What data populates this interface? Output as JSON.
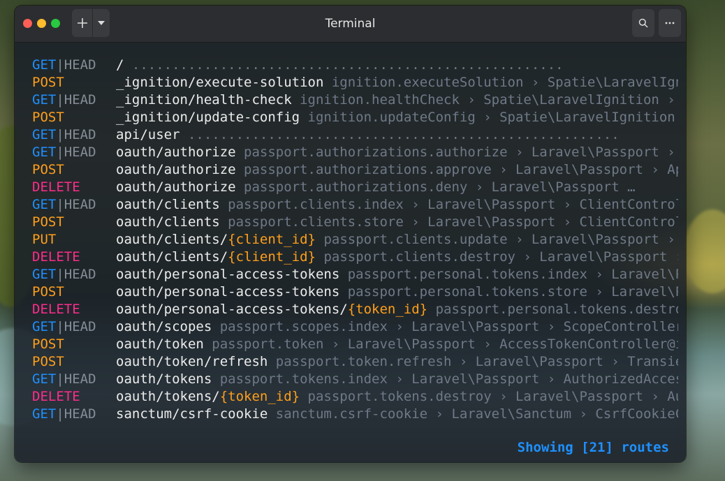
{
  "window": {
    "title": "Terminal",
    "new_tab_label": "+",
    "dropdown_label": "▾",
    "search_label": "⌕",
    "menu_label": "⋯"
  },
  "colors": {
    "get": "#1e90ff",
    "post": "#ff9f1a",
    "delete": "#ff2c8c",
    "put": "#ff9f1a",
    "head": "#858d98",
    "path": "#ececec",
    "dim": "#6f7987",
    "footer": "#1e90ff"
  },
  "routes": [
    {
      "method": "GET",
      "head": true,
      "path": "/",
      "param": "",
      "suffix": "",
      "info": " ......................................................"
    },
    {
      "method": "POST",
      "head": false,
      "path": "_ignition/execute-solution",
      "param": "",
      "suffix": "",
      "info": " ignition.executeSolution › Spatie\\LaravelIgnition › ExecuteSolutionController"
    },
    {
      "method": "GET",
      "head": true,
      "path": "_ignition/health-check",
      "param": "",
      "suffix": "",
      "info": " ignition.healthCheck › Spatie\\LaravelIgnition › HealthCheckController"
    },
    {
      "method": "POST",
      "head": false,
      "path": "_ignition/update-config",
      "param": "",
      "suffix": "",
      "info": " ignition.updateConfig › Spatie\\LaravelIgnition › UpdateConfigController"
    },
    {
      "method": "GET",
      "head": true,
      "path": "api/user",
      "param": "",
      "suffix": "",
      "info": " ......................................................"
    },
    {
      "method": "GET",
      "head": true,
      "path": "oauth/authorize",
      "param": "",
      "suffix": "",
      "info": " passport.authorizations.authorize › Laravel\\Passport › AuthorizationController"
    },
    {
      "method": "POST",
      "head": false,
      "path": "oauth/authorize",
      "param": "",
      "suffix": "",
      "info": " passport.authorizations.approve › Laravel\\Passport › ApproveAuthorizationController"
    },
    {
      "method": "DELETE",
      "head": false,
      "path": "oauth/authorize",
      "param": "",
      "suffix": "",
      "info": " passport.authorizations.deny › Laravel\\Passport  …"
    },
    {
      "method": "GET",
      "head": true,
      "path": "oauth/clients",
      "param": "",
      "suffix": "",
      "info": " passport.clients.index › Laravel\\Passport › ClientController@forUser"
    },
    {
      "method": "POST",
      "head": false,
      "path": "oauth/clients",
      "param": "",
      "suffix": "",
      "info": " passport.clients.store › Laravel\\Passport › ClientController@store"
    },
    {
      "method": "PUT",
      "head": false,
      "path": "oauth/clients/",
      "param": "{client_id}",
      "suffix": "",
      "info": " passport.clients.update › Laravel\\Passport › ClientController@update"
    },
    {
      "method": "DELETE",
      "head": false,
      "path": "oauth/clients/",
      "param": "{client_id}",
      "suffix": "",
      "info": " passport.clients.destroy › Laravel\\Passport › ClientController@destroy"
    },
    {
      "method": "GET",
      "head": true,
      "path": "oauth/personal-access-tokens",
      "param": "",
      "suffix": "",
      "info": " passport.personal.tokens.index › Laravel\\Passport › PersonalAccessTokenController"
    },
    {
      "method": "POST",
      "head": false,
      "path": "oauth/personal-access-tokens",
      "param": "",
      "suffix": "",
      "info": " passport.personal.tokens.store › Laravel\\Passport › PersonalAccessTokenController"
    },
    {
      "method": "DELETE",
      "head": false,
      "path": "oauth/personal-access-tokens/",
      "param": "{token_id}",
      "suffix": "",
      "info": " passport.personal.tokens.destroy › Laravel\\Passport"
    },
    {
      "method": "GET",
      "head": true,
      "path": "oauth/scopes",
      "param": "",
      "suffix": "",
      "info": " passport.scopes.index › Laravel\\Passport › ScopeController@all"
    },
    {
      "method": "POST",
      "head": false,
      "path": "oauth/token",
      "param": "",
      "suffix": "",
      "info": " passport.token › Laravel\\Passport › AccessTokenController@issueToken"
    },
    {
      "method": "POST",
      "head": false,
      "path": "oauth/token/refresh",
      "param": "",
      "suffix": "",
      "info": " passport.token.refresh › Laravel\\Passport › TransientTokenController@refresh"
    },
    {
      "method": "GET",
      "head": true,
      "path": "oauth/tokens",
      "param": "",
      "suffix": "",
      "info": " passport.tokens.index › Laravel\\Passport › AuthorizedAccessTokenController@forUser"
    },
    {
      "method": "DELETE",
      "head": false,
      "path": "oauth/tokens/",
      "param": "{token_id}",
      "suffix": "",
      "info": " passport.tokens.destroy › Laravel\\Passport › AuthorizedAccessTokenController"
    },
    {
      "method": "GET",
      "head": true,
      "path": "sanctum/csrf-cookie",
      "param": "",
      "suffix": "",
      "info": " sanctum.csrf-cookie › Laravel\\Sanctum › CsrfCookieController@show"
    }
  ],
  "head_label": "HEAD",
  "separator": "|",
  "ellipsis": "…",
  "footer": "Showing [21] routes"
}
